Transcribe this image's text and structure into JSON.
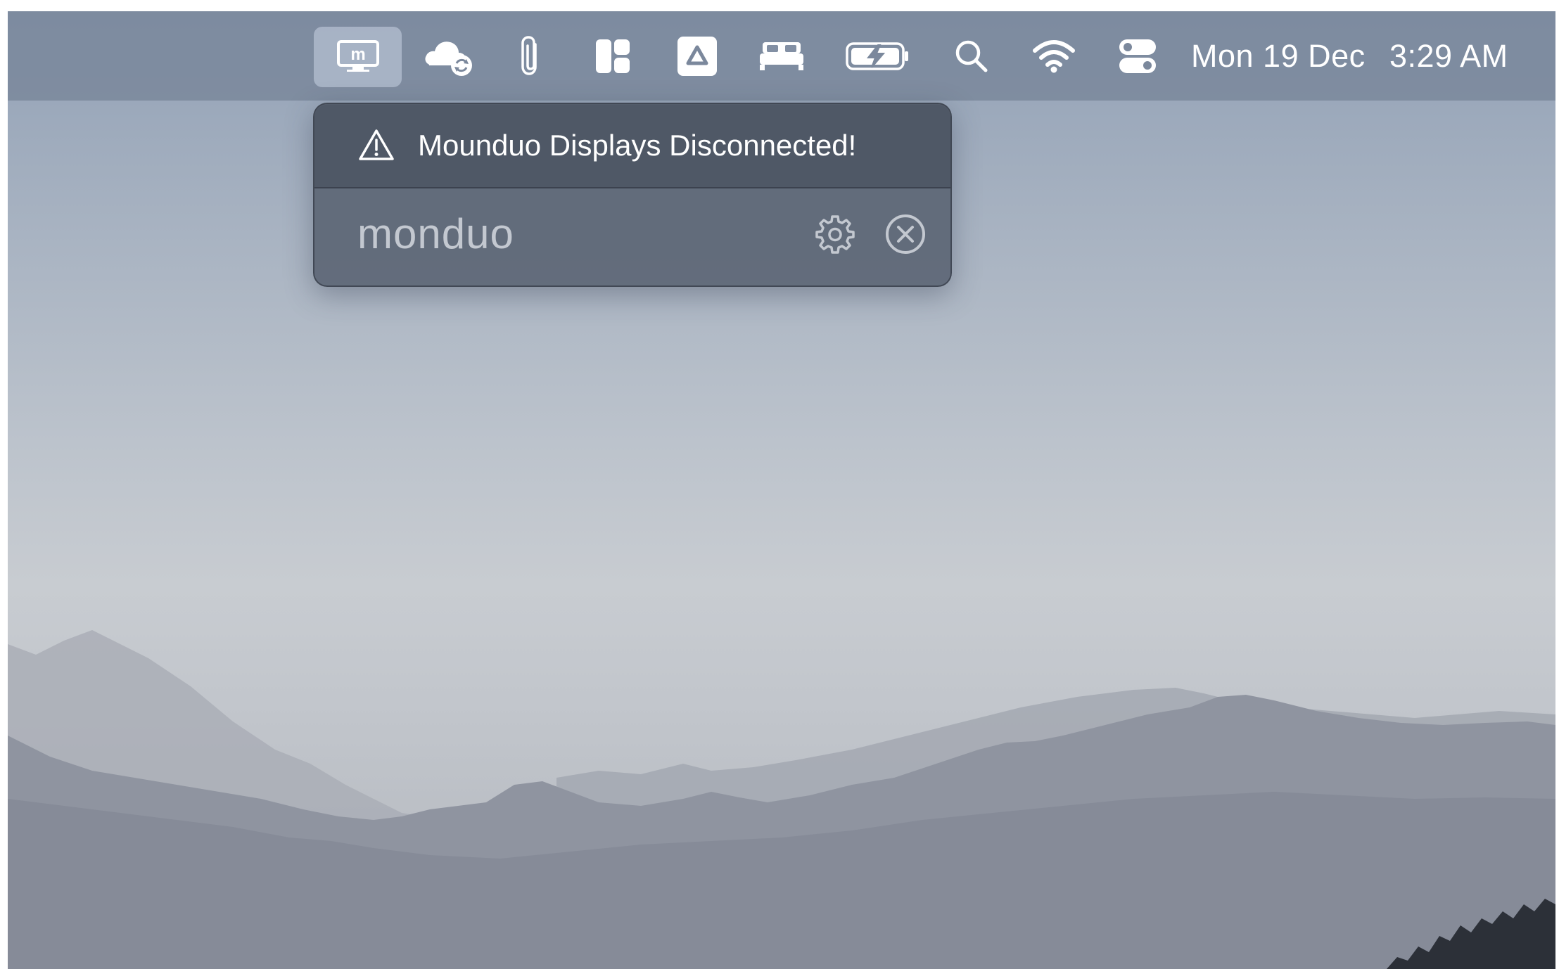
{
  "menubar": {
    "status_icons": [
      {
        "name": "monduo-icon",
        "active": true
      },
      {
        "name": "cloud-sync-icon"
      },
      {
        "name": "paperclip-icon"
      },
      {
        "name": "window-layout-icon"
      },
      {
        "name": "google-drive-icon"
      },
      {
        "name": "bed-icon"
      },
      {
        "name": "battery-charging-icon"
      },
      {
        "name": "spotlight-search-icon"
      },
      {
        "name": "wifi-icon"
      },
      {
        "name": "control-center-icon"
      }
    ],
    "date": "Mon 19 Dec",
    "time": "3:29 AM"
  },
  "popover": {
    "alert_icon": "warning-triangle-icon",
    "alert_text": "Mounduo Displays Disconnected!",
    "brand": "monduo",
    "actions": [
      {
        "name": "settings-gear-icon"
      },
      {
        "name": "close-circle-icon"
      }
    ]
  },
  "colors": {
    "menubar": "#78869a",
    "popover": "#5c6675",
    "alert_bar": "#4c5563",
    "brand_text": "#c3c8d0",
    "icon": "#ffffff"
  }
}
